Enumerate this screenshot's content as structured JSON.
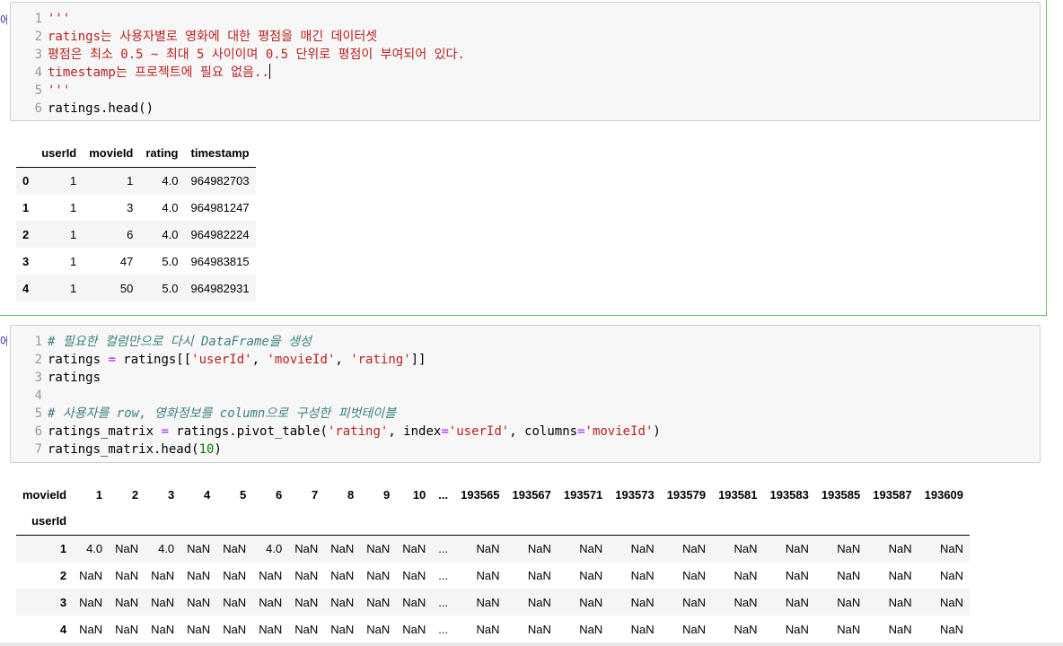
{
  "prompt_stub": "에",
  "cell1": {
    "lines": [
      {
        "n": "1",
        "segs": [
          {
            "t": "'''",
            "c": "str"
          }
        ]
      },
      {
        "n": "2",
        "segs": [
          {
            "t": "ratings는 사용자별로 영화에 대한 평점을 매긴 데이터셋",
            "c": "str"
          }
        ]
      },
      {
        "n": "3",
        "segs": [
          {
            "t": "평점은 최소 0.5 ~ 최대 5 사이이며 0.5 단위로 평점이 부여되어 있다.",
            "c": "str"
          }
        ]
      },
      {
        "n": "4",
        "segs": [
          {
            "t": "timestamp는 프로젝트에 필요 없음..",
            "c": "str"
          }
        ],
        "caret": true
      },
      {
        "n": "5",
        "segs": [
          {
            "t": "'''",
            "c": "str"
          }
        ]
      },
      {
        "n": "6",
        "segs": [
          {
            "t": "ratings.head()",
            "c": ""
          }
        ]
      }
    ],
    "table": {
      "columns": [
        "",
        "userId",
        "movieId",
        "rating",
        "timestamp"
      ],
      "rows": [
        [
          "0",
          "1",
          "1",
          "4.0",
          "964982703"
        ],
        [
          "1",
          "1",
          "3",
          "4.0",
          "964981247"
        ],
        [
          "2",
          "1",
          "6",
          "4.0",
          "964982224"
        ],
        [
          "3",
          "1",
          "47",
          "5.0",
          "964983815"
        ],
        [
          "4",
          "1",
          "50",
          "5.0",
          "964982931"
        ]
      ]
    }
  },
  "cell2": {
    "lines": [
      {
        "n": "1",
        "segs": [
          {
            "t": "# 필요한 컬럼만으로 다시 DataFrame을 생성",
            "c": "cmt"
          }
        ]
      },
      {
        "n": "2",
        "segs": [
          {
            "t": "ratings ",
            "c": ""
          },
          {
            "t": "=",
            "c": "op"
          },
          {
            "t": " ratings[[",
            "c": ""
          },
          {
            "t": "'userId'",
            "c": "str"
          },
          {
            "t": ", ",
            "c": ""
          },
          {
            "t": "'movieId'",
            "c": "str"
          },
          {
            "t": ", ",
            "c": ""
          },
          {
            "t": "'rating'",
            "c": "str"
          },
          {
            "t": "]]",
            "c": ""
          }
        ]
      },
      {
        "n": "3",
        "segs": [
          {
            "t": "ratings",
            "c": ""
          }
        ]
      },
      {
        "n": "4",
        "segs": [
          {
            "t": "",
            "c": ""
          }
        ]
      },
      {
        "n": "5",
        "segs": [
          {
            "t": "# 사용자를 row, 영화정보를 column으로 구성한 피벗테이블",
            "c": "cmt"
          }
        ]
      },
      {
        "n": "6",
        "segs": [
          {
            "t": "ratings_matrix ",
            "c": ""
          },
          {
            "t": "=",
            "c": "op"
          },
          {
            "t": " ratings.pivot_table(",
            "c": ""
          },
          {
            "t": "'rating'",
            "c": "str"
          },
          {
            "t": ", index",
            "c": ""
          },
          {
            "t": "=",
            "c": "op"
          },
          {
            "t": "'userId'",
            "c": "str"
          },
          {
            "t": ", columns",
            "c": ""
          },
          {
            "t": "=",
            "c": "op"
          },
          {
            "t": "'movieId'",
            "c": "str"
          },
          {
            "t": ")",
            "c": ""
          }
        ]
      },
      {
        "n": "7",
        "segs": [
          {
            "t": "ratings_matrix.head(",
            "c": ""
          },
          {
            "t": "10",
            "c": "num"
          },
          {
            "t": ")",
            "c": ""
          }
        ]
      }
    ],
    "table": {
      "header1": [
        "movieId",
        "1",
        "2",
        "3",
        "4",
        "5",
        "6",
        "7",
        "8",
        "9",
        "10",
        "...",
        "193565",
        "193567",
        "193571",
        "193573",
        "193579",
        "193581",
        "193583",
        "193585",
        "193587",
        "193609"
      ],
      "header2_label": "userId",
      "rows": [
        [
          "1",
          "4.0",
          "NaN",
          "4.0",
          "NaN",
          "NaN",
          "4.0",
          "NaN",
          "NaN",
          "NaN",
          "NaN",
          "...",
          "NaN",
          "NaN",
          "NaN",
          "NaN",
          "NaN",
          "NaN",
          "NaN",
          "NaN",
          "NaN",
          "NaN"
        ],
        [
          "2",
          "NaN",
          "NaN",
          "NaN",
          "NaN",
          "NaN",
          "NaN",
          "NaN",
          "NaN",
          "NaN",
          "NaN",
          "...",
          "NaN",
          "NaN",
          "NaN",
          "NaN",
          "NaN",
          "NaN",
          "NaN",
          "NaN",
          "NaN",
          "NaN"
        ],
        [
          "3",
          "NaN",
          "NaN",
          "NaN",
          "NaN",
          "NaN",
          "NaN",
          "NaN",
          "NaN",
          "NaN",
          "NaN",
          "...",
          "NaN",
          "NaN",
          "NaN",
          "NaN",
          "NaN",
          "NaN",
          "NaN",
          "NaN",
          "NaN",
          "NaN"
        ],
        [
          "4",
          "NaN",
          "NaN",
          "NaN",
          "NaN",
          "NaN",
          "NaN",
          "NaN",
          "NaN",
          "NaN",
          "NaN",
          "...",
          "NaN",
          "NaN",
          "NaN",
          "NaN",
          "NaN",
          "NaN",
          "NaN",
          "NaN",
          "NaN",
          "NaN"
        ]
      ]
    }
  }
}
